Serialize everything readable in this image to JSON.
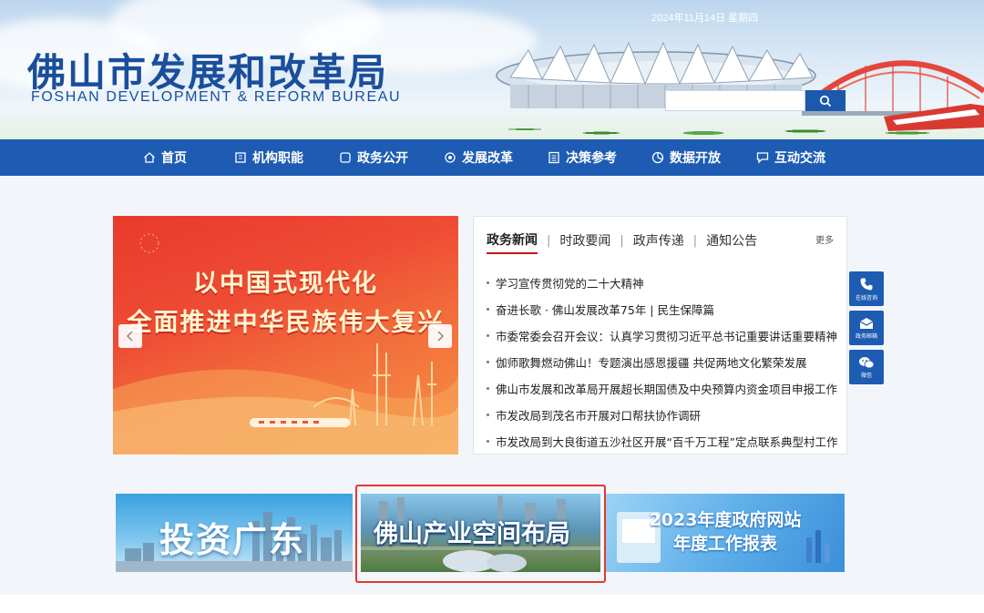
{
  "header": {
    "title": "佛山市发展和改革局",
    "subtitle": "FOSHAN DEVELOPMENT & REFORM BUREAU",
    "date": "2024年11月14日 星期四",
    "search": {
      "placeholder": "",
      "icon": "search-icon"
    }
  },
  "nav": {
    "items": [
      {
        "label": "首页",
        "icon": "home-icon"
      },
      {
        "label": "机构职能",
        "icon": "building-icon"
      },
      {
        "label": "政务公开",
        "icon": "document-icon"
      },
      {
        "label": "发展改革",
        "icon": "target-icon"
      },
      {
        "label": "决策参考",
        "icon": "list-icon"
      },
      {
        "label": "数据开放",
        "icon": "pie-icon"
      },
      {
        "label": "互动交流",
        "icon": "chat-icon"
      }
    ]
  },
  "banner": {
    "line1": "以中国式现代化",
    "line2": "全面推进中华民族伟大复兴",
    "prev_icon": "chevron-left-icon",
    "next_icon": "chevron-right-icon"
  },
  "news": {
    "tabs": [
      "政务新闻",
      "时政要闻",
      "政声传递",
      "通知公告"
    ],
    "active_tab": 0,
    "more": "更多",
    "items": [
      "学习宣传贯彻党的二十大精神",
      "奋进长歌 · 佛山发展改革75年 | 民生保障篇",
      "市委常委会召开会议：认真学习贯彻习近平总书记重要讲话重要精神",
      "伽师歌舞燃动佛山！专题演出感恩援疆 共促两地文化繁荣发展",
      "佛山市发展和改革局开展超长期国债及中央预算内资金项目申报工作",
      "市发改局到茂名市开展对口帮扶协作调研",
      "市发改局到大良街道五沙社区开展“百千万工程”定点联系典型村工作"
    ]
  },
  "float_buttons": [
    {
      "label": "在线咨询",
      "icon": "phone-icon"
    },
    {
      "label": "政务邮箱",
      "icon": "mail-icon"
    },
    {
      "label": "微信",
      "icon": "wechat-icon"
    }
  ],
  "promos": [
    {
      "text": "投资广东"
    },
    {
      "text": "佛山产业空间布局"
    },
    {
      "line1": "2023年度政府网站",
      "line2": "年度工作报表"
    }
  ],
  "colors": {
    "brand_blue": "#1d5cb2",
    "title_blue": "#1a4e9c",
    "banner_red": "#e93a2c",
    "active_tab_underline": "#c8161d",
    "highlight_frame": "#e5372f"
  }
}
